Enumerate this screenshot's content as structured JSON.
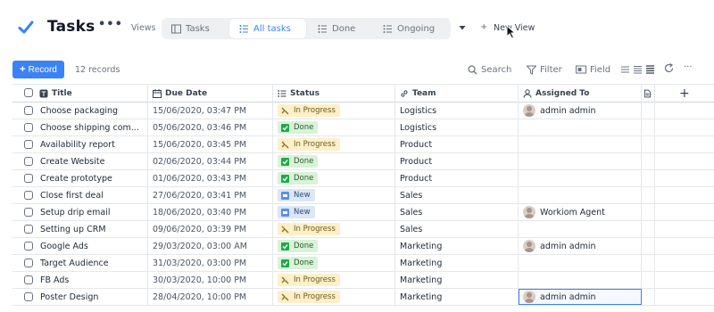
{
  "header": {
    "title": "Tasks",
    "title_menu_glyph": "•••",
    "views_label": "Views",
    "tabs": [
      {
        "label": "Tasks",
        "icon": "table-icon",
        "active": false
      },
      {
        "label": "All tasks",
        "icon": "list-icon",
        "active": true
      },
      {
        "label": "Done",
        "icon": "list-icon",
        "active": false
      },
      {
        "label": "Ongoing",
        "icon": "list-icon",
        "active": false
      }
    ],
    "new_view_plus": "+",
    "new_view_label": "New View"
  },
  "toolbar": {
    "record_plus": "+",
    "record_label": "Record",
    "records_count": "12 records",
    "search_label": "Search",
    "filter_label": "Filter",
    "field_label": "Field",
    "more_glyph": "···"
  },
  "table": {
    "columns": [
      {
        "label": "Title",
        "icon": "title-icon"
      },
      {
        "label": "Due Date",
        "icon": "calendar-icon"
      },
      {
        "label": "Status",
        "icon": "list-icon"
      },
      {
        "label": "Team",
        "icon": "link-icon"
      },
      {
        "label": "Assigned To",
        "icon": "user-icon"
      }
    ],
    "add_column_glyph": "+",
    "rows": [
      {
        "title": "Choose packaging",
        "due": "15/06/2020, 03:47 PM",
        "status": "In Progress",
        "team": "Logistics",
        "assigned": "admin admin"
      },
      {
        "title": "Choose shipping com...",
        "due": "05/06/2020, 03:46 PM",
        "status": "Done",
        "team": "Logistics",
        "assigned": ""
      },
      {
        "title": "Availability report",
        "due": "15/06/2020, 03:45 PM",
        "status": "In Progress",
        "team": "Product",
        "assigned": ""
      },
      {
        "title": "Create Website",
        "due": "02/06/2020, 03:44 PM",
        "status": "Done",
        "team": "Product",
        "assigned": ""
      },
      {
        "title": "Create prototype",
        "due": "01/06/2020, 03:43 PM",
        "status": "Done",
        "team": "Product",
        "assigned": ""
      },
      {
        "title": "Close first deal",
        "due": "27/06/2020, 03:41 PM",
        "status": "New",
        "team": "Sales",
        "assigned": ""
      },
      {
        "title": "Setup drip email",
        "due": "18/06/2020, 03:40 PM",
        "status": "New",
        "team": "Sales",
        "assigned": "Workiom Agent"
      },
      {
        "title": "Setting up CRM",
        "due": "09/06/2020, 03:39 PM",
        "status": "In Progress",
        "team": "Sales",
        "assigned": ""
      },
      {
        "title": "Google Ads",
        "due": "29/03/2020, 03:00 AM",
        "status": "Done",
        "team": "Marketing",
        "assigned": "admin admin"
      },
      {
        "title": "Target Audience",
        "due": "31/03/2020, 03:00 PM",
        "status": "Done",
        "team": "Marketing",
        "assigned": ""
      },
      {
        "title": "FB Ads",
        "due": "30/03/2020, 10:00 PM",
        "status": "In Progress",
        "team": "Marketing",
        "assigned": ""
      },
      {
        "title": "Poster Design",
        "due": "28/04/2020, 10:00 PM",
        "status": "In Progress",
        "team": "Marketing",
        "assigned": "admin admin",
        "selected_assigned": true
      }
    ]
  },
  "colors": {
    "accent": "#3b82f6",
    "in_progress_bg": "#fdf0c9",
    "done_bg": "#d8f3d8",
    "new_bg": "#dbe6f7"
  }
}
